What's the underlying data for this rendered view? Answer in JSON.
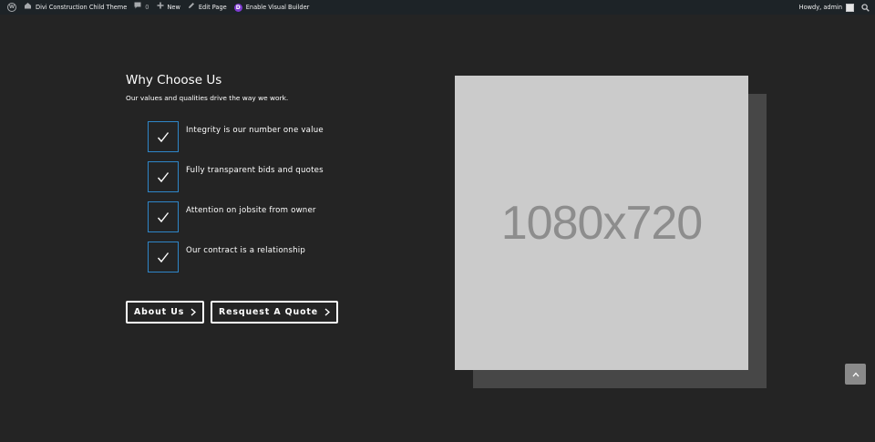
{
  "admin_bar": {
    "site_name": "Divi Construction Child Theme",
    "comments_count": "0",
    "new_label": "New",
    "edit_label": "Edit Page",
    "builder_label": "Enable Visual Builder",
    "greeting": "Howdy, admin",
    "icons": {
      "wp": "wordpress-logo-icon",
      "site": "home-icon",
      "comments": "comment-bubble-icon",
      "new": "plus-icon",
      "edit": "pencil-icon",
      "builder": "divi-logo-icon",
      "search": "search-icon"
    }
  },
  "section": {
    "title": "Why Choose Us",
    "subtitle": "Our values and qualities drive the way we work."
  },
  "features": [
    "Integrity is our number one value",
    "Fully transparent bids and quotes",
    "Attention on jobsite from owner",
    "Our contract is a relationship"
  ],
  "buttons": {
    "about": "About Us",
    "quote": "Resquest A Quote"
  },
  "image": {
    "placeholder_text": "1080x720"
  },
  "colors": {
    "background": "#242424",
    "accent_border": "#2e86c9",
    "placeholder": "#cbcbcb",
    "shadow": "#474747",
    "admin_bar": "#1d2327"
  }
}
